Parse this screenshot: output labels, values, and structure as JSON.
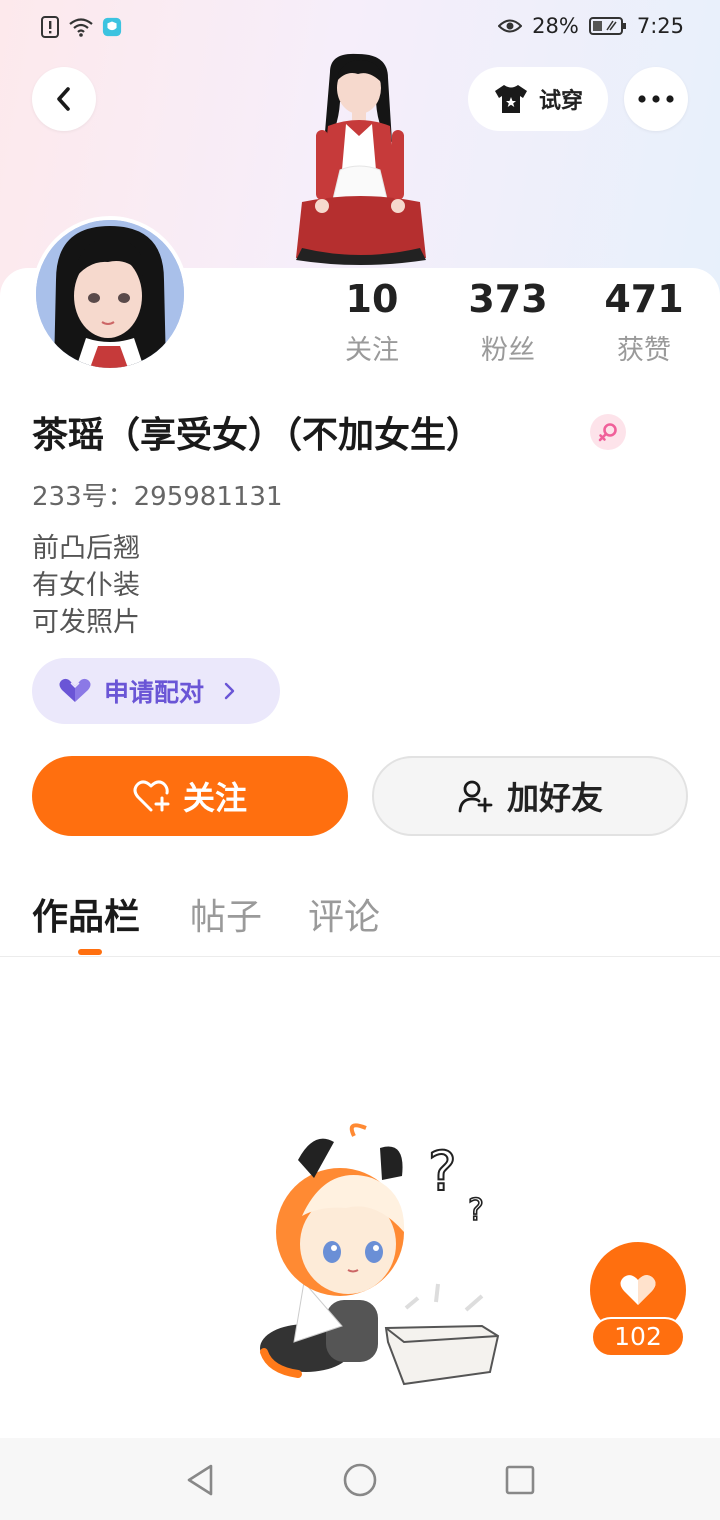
{
  "status_bar": {
    "battery": "28%",
    "time": "7:25"
  },
  "header": {
    "try_on_label": "试穿"
  },
  "stats": [
    {
      "value": "10",
      "label": "关注"
    },
    {
      "value": "373",
      "label": "粉丝"
    },
    {
      "value": "471",
      "label": "获赞"
    }
  ],
  "profile": {
    "nickname": "茶瑶（享受女）（不加女生）",
    "uid": "233号：295981131",
    "bio": [
      "前凸后翘",
      "有女仆装",
      "可发照片"
    ],
    "gender_icon": "female-icon"
  },
  "actions": {
    "pair_label": "申请配对",
    "follow_label": "关注",
    "add_friend_label": "加好友"
  },
  "tabs": [
    {
      "label": "作品栏",
      "active": true
    },
    {
      "label": "帖子",
      "active": false
    },
    {
      "label": "评论",
      "active": false
    }
  ],
  "like": {
    "count": "102"
  },
  "colors": {
    "accent": "#ff6f0f",
    "pair_text": "#6a55d6",
    "pair_bg": "#ebe8fb"
  }
}
